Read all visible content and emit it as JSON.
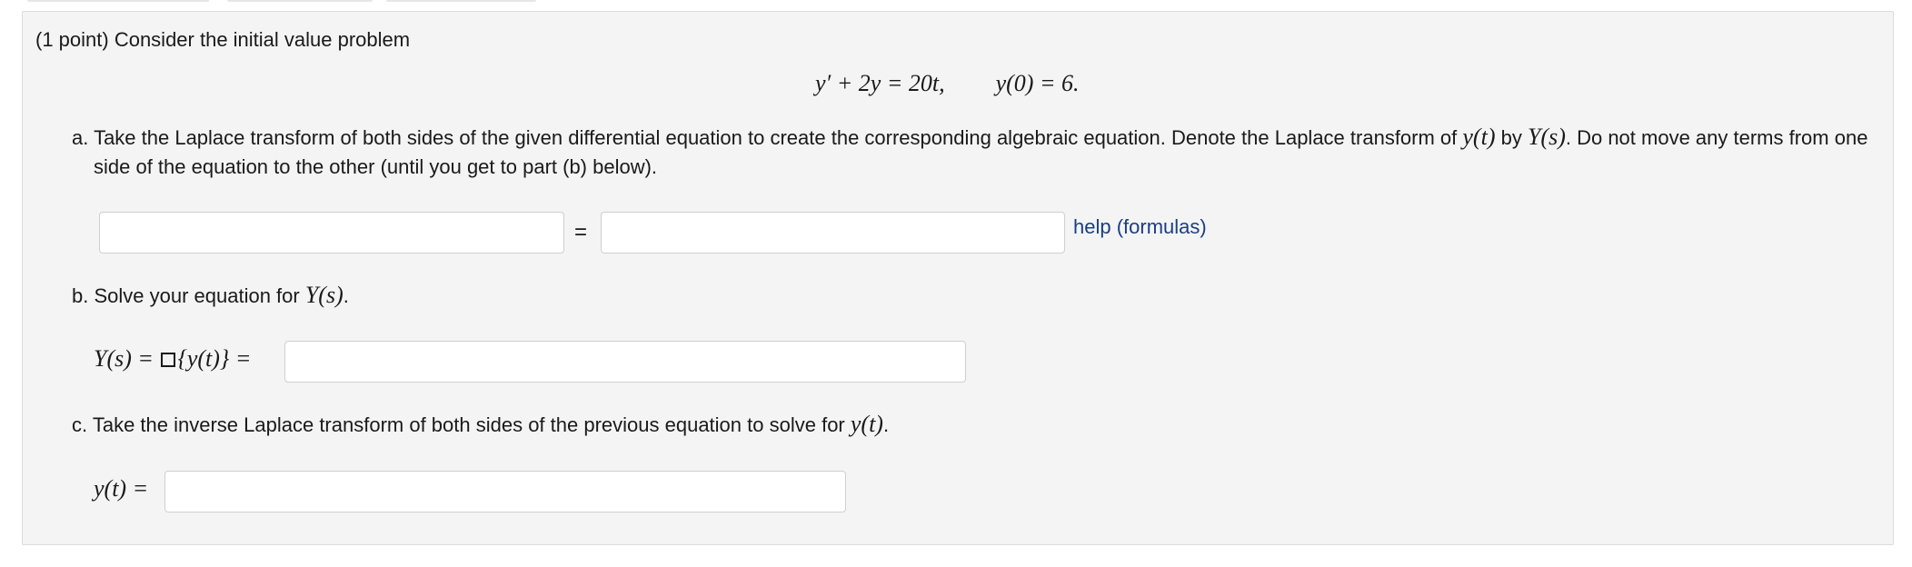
{
  "problem": {
    "intro": "(1 point) Consider the initial value problem",
    "ode_lhs": "y′ + 2y = 20t,",
    "ode_ic": "y(0) = 6."
  },
  "part_a": {
    "text_1": "a. Take the Laplace transform of both sides of the given differential equation to create the corresponding algebraic equation. Denote the Laplace transform of ",
    "math_1": "y(t)",
    "text_2": " by ",
    "math_2": "Y(s)",
    "text_3": ". Do not move any terms from one side of the equation to the other (until you get to part (b) below).",
    "equals": "=",
    "lhs_value": "",
    "rhs_value": "",
    "help_link": "help (formulas)"
  },
  "part_b": {
    "text": "b. Solve your equation for ",
    "math": "Y(s)",
    "text_end": ".",
    "expr_left": "Y(s) = ",
    "expr_right": "{y(t)} =",
    "answer_value": ""
  },
  "part_c": {
    "text": "c. Take the inverse Laplace transform of both sides of the previous equation to solve for ",
    "math": "y(t)",
    "text_end": ".",
    "expr": "y(t) =",
    "answer_value": ""
  },
  "colors": {
    "panel_bg": "#f4f4f4",
    "link": "#1a3e85"
  }
}
